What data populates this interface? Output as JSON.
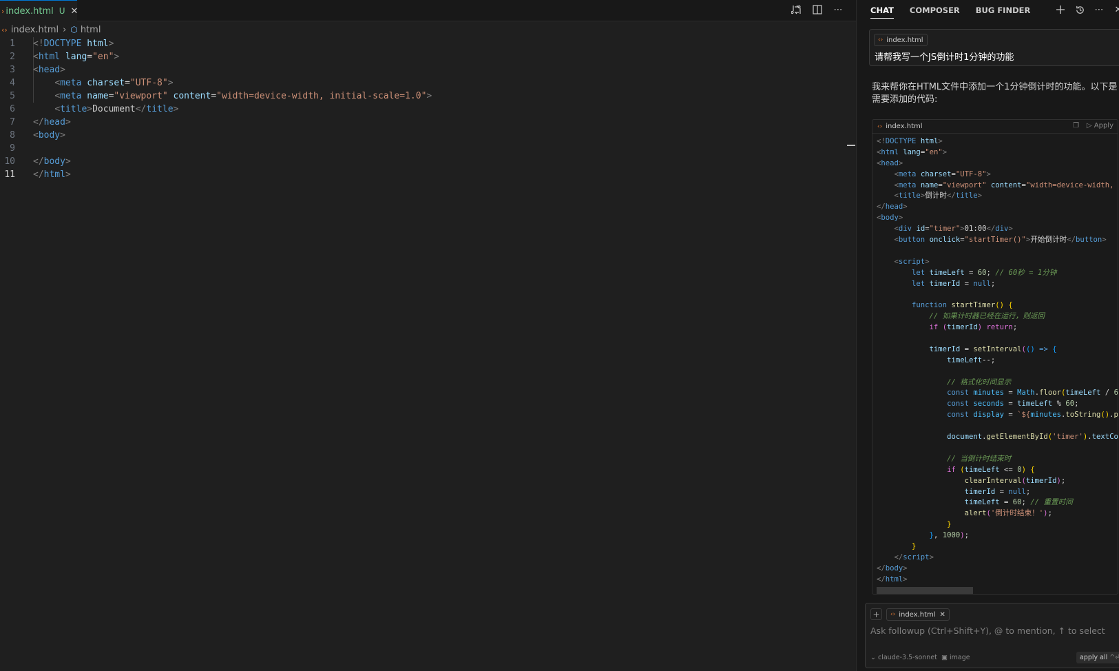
{
  "editor": {
    "tab": {
      "filename": "index.html",
      "status": "U"
    },
    "breadcrumb": {
      "file": "index.html",
      "symbol": "html"
    },
    "current_line": 11
  },
  "panel": {
    "tabs": [
      "CHAT",
      "COMPOSER",
      "BUG FINDER"
    ],
    "user_message": {
      "file_chip": "index.html",
      "text": "请帮我写一个JS倒计时1分钟的功能"
    },
    "assistant_reply": "我来帮你在HTML文件中添加一个1分钟倒计时的功能。以下是需要添加的代码:",
    "code_block": {
      "filename": "index.html",
      "apply_label": "Apply"
    },
    "followup": {
      "file_chip": "index.html",
      "placeholder": "Ask followup (Ctrl+Shift+Y), @ to mention, ↑ to select",
      "model": "claude-3.5-sonnet",
      "image_label": "image",
      "apply_all": "apply all",
      "apply_all_shortcut": "^⏎"
    }
  }
}
